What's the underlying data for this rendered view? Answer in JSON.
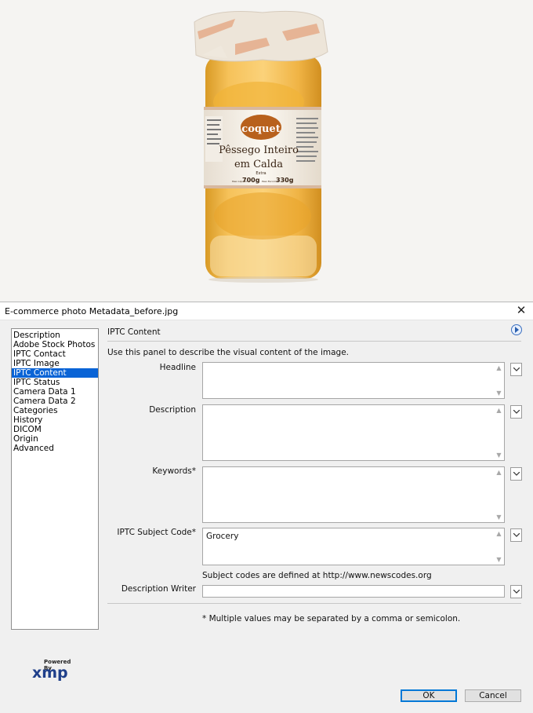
{
  "window": {
    "title": "E-commerce photo Metadata_before.jpg"
  },
  "photo": {
    "brand": "coquet",
    "product_line1": "Pêssego Inteiro",
    "product_line2": "em Calda",
    "grade": "Extra",
    "weight_left_label": "Peso Liquido",
    "weight_left": "700g",
    "weight_right_label": "Peso Escorrido",
    "weight_right": "330g"
  },
  "nav": {
    "items": [
      {
        "label": "Description",
        "selected": false
      },
      {
        "label": "Adobe Stock Photos",
        "selected": false
      },
      {
        "label": "IPTC Contact",
        "selected": false
      },
      {
        "label": "IPTC Image",
        "selected": false
      },
      {
        "label": "IPTC Content",
        "selected": true
      },
      {
        "label": "IPTC Status",
        "selected": false
      },
      {
        "label": "Camera Data 1",
        "selected": false
      },
      {
        "label": "Camera Data 2",
        "selected": false
      },
      {
        "label": "Categories",
        "selected": false
      },
      {
        "label": "History",
        "selected": false
      },
      {
        "label": "DICOM",
        "selected": false
      },
      {
        "label": "Origin",
        "selected": false
      },
      {
        "label": "Advanced",
        "selected": false
      }
    ]
  },
  "panel": {
    "title": "IPTC Content",
    "description": "Use this panel to describe the visual content of the image.",
    "fields": {
      "headline": {
        "label": "Headline",
        "value": ""
      },
      "description": {
        "label": "Description",
        "value": ""
      },
      "keywords": {
        "label": "Keywords*",
        "value": ""
      },
      "subject_code": {
        "label": "IPTC Subject Code*",
        "value": "Grocery"
      },
      "description_writer": {
        "label": "Description Writer",
        "value": ""
      }
    },
    "subject_codes_note": "Subject codes are defined at http://www.newscodes.org",
    "multi_value_note": "* Multiple values may be separated by a comma or semicolon."
  },
  "footer": {
    "powered_by": "Powered By",
    "logo": "xmp",
    "ok_label": "OK",
    "cancel_label": "Cancel"
  },
  "colors": {
    "selection": "#0a64d6",
    "xmp_logo": "#1f3f8a",
    "ok_border": "#0078d7"
  }
}
